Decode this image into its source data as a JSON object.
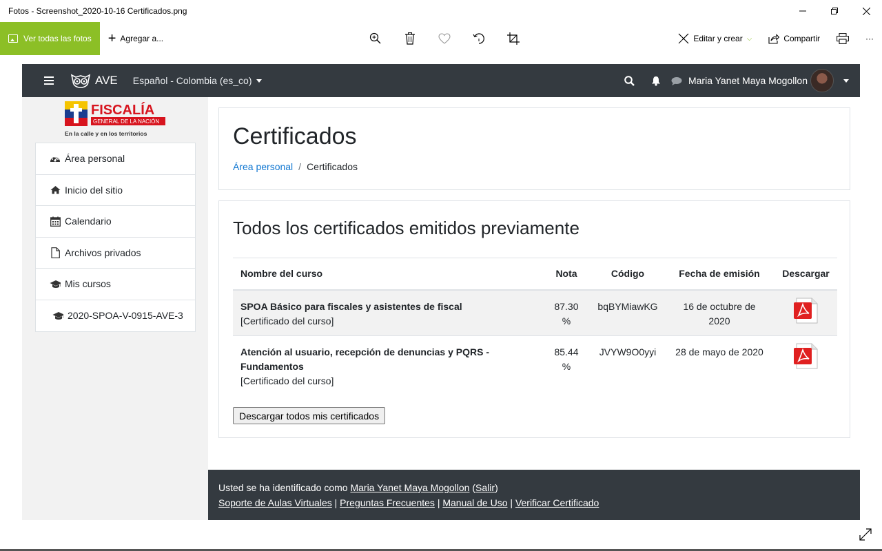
{
  "window": {
    "title": "Fotos - Screenshot_2020-10-16 Certificados.png"
  },
  "photos_toolbar": {
    "see_all": "Ver todas las fotos",
    "add_to": "Agregar a...",
    "edit_create": "Editar y crear",
    "share": "Compartir",
    "more": "···"
  },
  "navbar": {
    "brand": "AVE",
    "language": "Español - Colombia (es_co)",
    "user": "Maria Yanet Maya Mogollon"
  },
  "logo": {
    "name": "FISCALÍA",
    "subtitle": "GENERAL DE LA NACIÓN",
    "tagline": "En la calle y en los territorios"
  },
  "sidebar": {
    "items": [
      {
        "label": "Área personal",
        "icon": "dashboard-icon"
      },
      {
        "label": "Inicio del sitio",
        "icon": "home-icon"
      },
      {
        "label": "Calendario",
        "icon": "calendar-icon"
      },
      {
        "label": "Archivos privados",
        "icon": "file-icon"
      },
      {
        "label": "Mis cursos",
        "icon": "graduation-cap-icon"
      },
      {
        "label": "2020-SPOA-V-0915-AVE-3",
        "icon": "graduation-cap-icon"
      }
    ]
  },
  "header": {
    "title": "Certificados",
    "breadcrumb": [
      "Área personal",
      "Certificados"
    ],
    "breadcrumb_sep": "/"
  },
  "certificates": {
    "title": "Todos los certificados emitidos previamente",
    "columns": [
      "Nombre del curso",
      "Nota",
      "Código",
      "Fecha de emisión",
      "Descargar"
    ],
    "rows": [
      {
        "course": "SPOA Básico para fiscales y asistentes de fiscal",
        "type": "[Certificado del curso]",
        "grade": "87.30 %",
        "code": "bqBYMiawKG",
        "date": "16 de octubre de 2020"
      },
      {
        "course": "Atención al usuario, recepción de denuncias y PQRS - Fundamentos",
        "type": "[Certificado del curso]",
        "grade": "85.44 %",
        "code": "JVYW9O0yyi",
        "date": "28 de mayo de 2020"
      }
    ],
    "download_all": "Descargar todos mis certificados"
  },
  "footer": {
    "logged_in_as": "Usted se ha identificado como",
    "user": "Maria Yanet Maya Mogollon",
    "logout": "Salir",
    "links": [
      "Soporte de Aulas Virtuales",
      "Preguntas Frecuentes",
      "Manual de Uso",
      "Verificar Certificado"
    ],
    "link_sep": "|"
  },
  "colors": {
    "accent_green": "#8cbf26",
    "navbar": "#343a40",
    "link": "#1177d1",
    "pdf_red": "#e02020"
  }
}
